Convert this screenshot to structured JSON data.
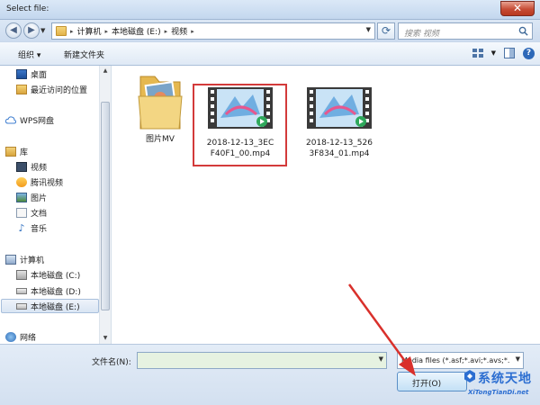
{
  "window": {
    "title": "Select file:",
    "close_glyph": "✕"
  },
  "address": {
    "crumbs": [
      "计算机",
      "本地磁盘 (E:)",
      "视频"
    ],
    "search_placeholder": "搜索 视频"
  },
  "toolbar": {
    "organize": "组织 ▾",
    "new_folder": "新建文件夹",
    "help": "?"
  },
  "nav": {
    "favorites": [
      "桌面",
      "最近访问的位置"
    ],
    "wps": "WPS网盘",
    "library": {
      "label": "库",
      "items": [
        "视频",
        "腾讯视频",
        "图片",
        "文档",
        "音乐"
      ]
    },
    "computer": {
      "label": "计算机",
      "items": [
        "本地磁盘 (C:)",
        "本地磁盘 (D:)",
        "本地磁盘 (E:)"
      ]
    },
    "network": "网络",
    "selected": "本地磁盘 (E:)"
  },
  "files": [
    {
      "name": "图片MV",
      "kind": "folder"
    },
    {
      "name": "2018-12-13_3ECF40F1_00.mp4",
      "kind": "video",
      "line1": "2018-12-13_3EC",
      "line2": "F40F1_00.mp4",
      "highlighted": true
    },
    {
      "name": "2018-12-13_5263F834_01.mp4",
      "kind": "video",
      "line1": "2018-12-13_526",
      "line2": "3F834_01.mp4"
    }
  ],
  "bottom": {
    "filename_label": "文件名(N):",
    "filename_value": "",
    "filetype_value": "Media files (*.asf;*.avi;*.avs;*.",
    "open_label": "打开(O)"
  },
  "watermark": {
    "title": "系统天地",
    "subtitle": "XiTongTianDi.net"
  },
  "colors": {
    "highlight": "#d33a3a",
    "accent": "#2c6ed1",
    "arrow": "#d9302b"
  }
}
